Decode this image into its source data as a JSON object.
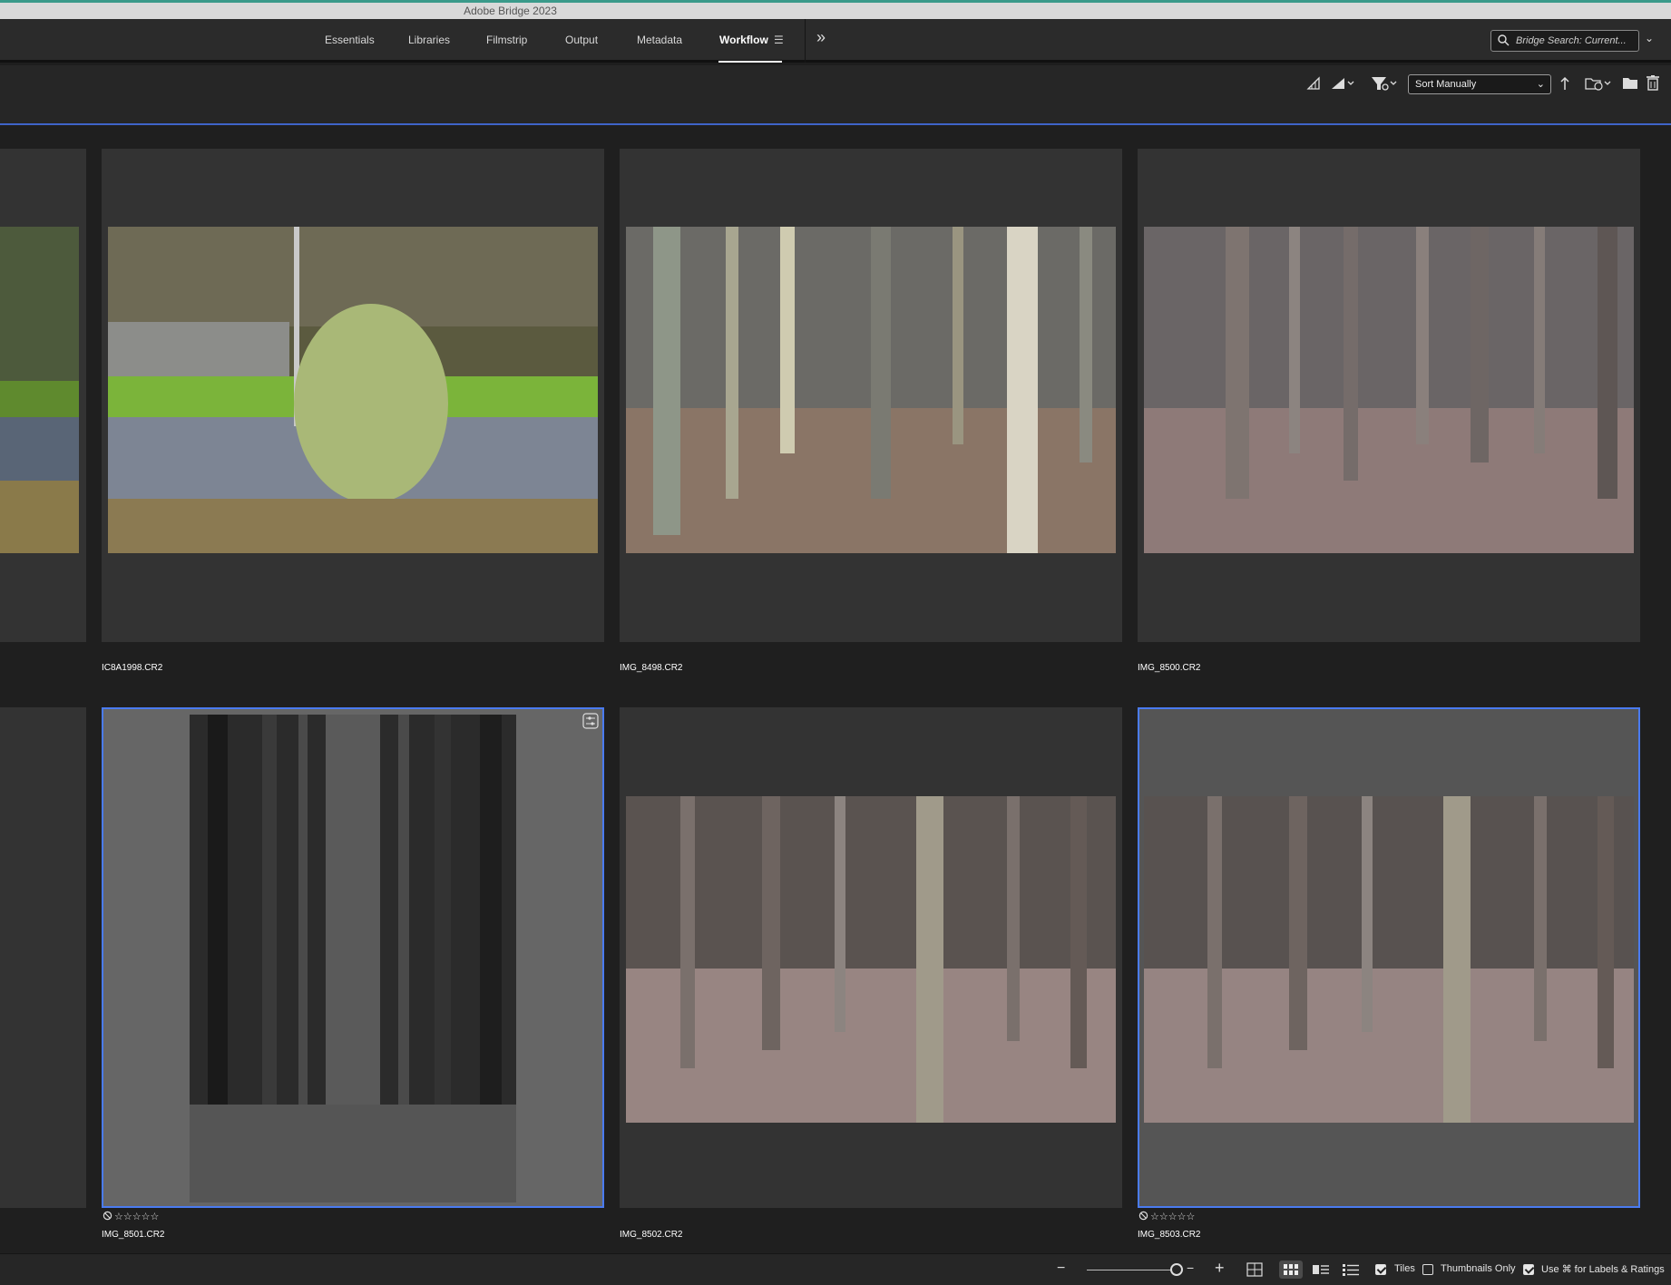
{
  "window": {
    "title": "Adobe Bridge 2023"
  },
  "workspaces": {
    "tabs": [
      {
        "label": "Essentials"
      },
      {
        "label": "Libraries"
      },
      {
        "label": "Filmstrip"
      },
      {
        "label": "Output"
      },
      {
        "label": "Metadata"
      },
      {
        "label": "Workflow",
        "active": true
      }
    ],
    "more_label": "»"
  },
  "search": {
    "placeholder": "Bridge Search: Current..."
  },
  "toolbar": {
    "sort_label": "Sort Manually"
  },
  "tiles": [
    {
      "filename": "IC8A1998.CR2"
    },
    {
      "filename": "IMG_8498.CR2"
    },
    {
      "filename": "IMG_8500.CR2"
    },
    {
      "filename": "IMG_8501.CR2",
      "stars": "☆☆☆☆☆"
    },
    {
      "filename": "IMG_8502.CR2"
    },
    {
      "filename": "IMG_8503.CR2",
      "stars": "☆☆☆☆☆"
    }
  ],
  "bottombar": {
    "zoom_out": "−",
    "zoom_in": "+",
    "tiles_label": "Tiles",
    "thumbs_only_label": "Thumbnails Only",
    "labels_ratings_label": "Use ⌘ for Labels & Ratings"
  },
  "colors": {
    "accent": "#4a7bf0",
    "title_bar": "#d9d9d9",
    "panel": "#333333"
  }
}
